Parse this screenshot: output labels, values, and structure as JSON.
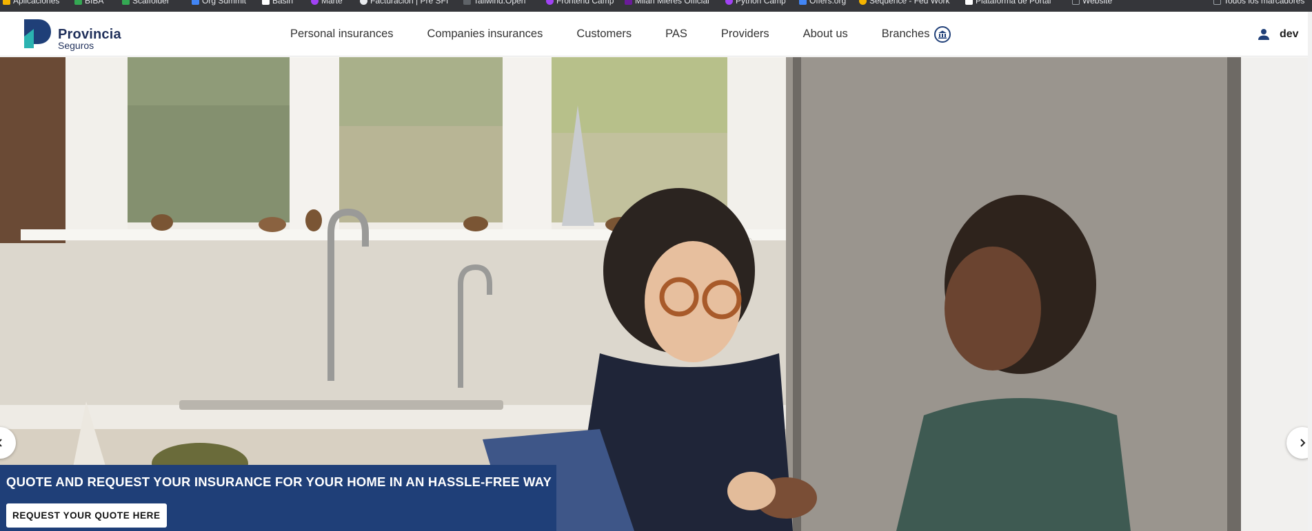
{
  "bookmarks": [
    {
      "label": "Aplicaciones",
      "color": "#f4b400"
    },
    {
      "label": "BIBA",
      "color": "#34a853"
    },
    {
      "label": "Scaffolder",
      "color": "#34a853"
    },
    {
      "label": "Org Summit",
      "color": "#4285f4"
    },
    {
      "label": "Basin",
      "color": "#ffffff"
    },
    {
      "label": "Marte",
      "color": "#a142f4"
    },
    {
      "label": "Facturación | Pre SFI",
      "color": "#e8eaed"
    },
    {
      "label": "Tailwind.Open",
      "color": "#5f6368"
    },
    {
      "label": "Frontend Camp",
      "color": "#a142f4"
    },
    {
      "label": "Milan Mieres Official",
      "color": "#6a1b9a"
    },
    {
      "label": "Python Camp",
      "color": "#a142f4"
    },
    {
      "label": "Offers.org",
      "color": "#4285f4"
    },
    {
      "label": "Sequence - Fed Work",
      "color": "#f4b400"
    },
    {
      "label": "Plataforma de Portal",
      "color": "#ffffff"
    },
    {
      "label": "Website",
      "color": "#9aa0a6"
    },
    {
      "label": "Todos los marcadores",
      "color": "#9aa0a6"
    }
  ],
  "brand": {
    "name": "Provincia",
    "sub": "Seguros",
    "colors": {
      "dark_blue": "#1f3f78",
      "teal": "#2bb3b1",
      "text": "#1f2f5a"
    }
  },
  "nav": {
    "items": [
      "Personal insurances",
      "Companies insurances",
      "Customers",
      "PAS",
      "Providers",
      "About us"
    ],
    "branches_label": "Branches",
    "branches_icon": "building-icon"
  },
  "user": {
    "icon": "person-icon",
    "label": "dev"
  },
  "hero": {
    "image_subject": "two women laughing at a kitchen table with a laptop",
    "prev_icon": "chevron-left-icon",
    "next_icon": "chevron-right-icon",
    "promo_title": "QUOTE AND REQUEST YOUR INSURANCE FOR YOUR HOME IN AN HASSLE-FREE WAY",
    "cta_label": "REQUEST YOUR QUOTE HERE"
  }
}
